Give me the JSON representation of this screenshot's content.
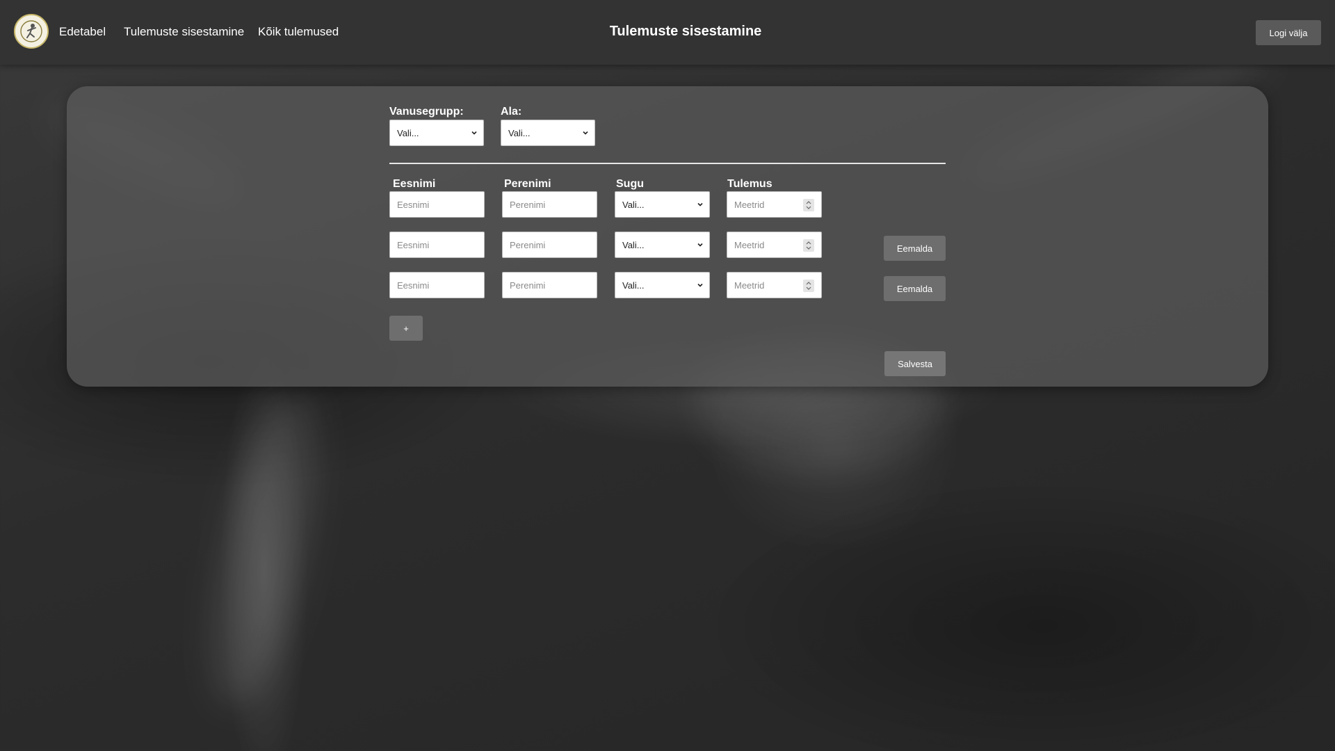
{
  "header": {
    "nav": [
      "Edetabel",
      "Tulemuste sisestamine",
      "Kõik tulemused"
    ],
    "title": "Tulemuste sisestamine",
    "logout_label": "Logi välja"
  },
  "filters": {
    "age_group_label": "Vanusegrupp:",
    "age_group_value": "Vali...",
    "event_label": "Ala:",
    "event_value": "Vali..."
  },
  "columns": {
    "first_name": "Eesnimi",
    "last_name": "Perenimi",
    "gender": "Sugu",
    "result": "Tulemus"
  },
  "rows": [
    {
      "first_name_placeholder": "Eesnimi",
      "last_name_placeholder": "Perenimi",
      "gender_value": "Vali...",
      "result_placeholder": "Meetrid"
    },
    {
      "first_name_placeholder": "Eesnimi",
      "last_name_placeholder": "Perenimi",
      "gender_value": "Vali...",
      "result_placeholder": "Meetrid",
      "remove_label": "Eemalda"
    },
    {
      "first_name_placeholder": "Eesnimi",
      "last_name_placeholder": "Perenimi",
      "gender_value": "Vali...",
      "result_placeholder": "Meetrid",
      "remove_label": "Eemalda"
    }
  ],
  "actions": {
    "add_label": "+",
    "save_label": "Salvesta"
  },
  "colors": {
    "header_bg": "#333333",
    "panel_bg": "#5c5c5c",
    "button_bg": "#6e6e6e"
  },
  "icons": [
    "logo-icon",
    "chevron-down-icon",
    "spinner-icon"
  ]
}
